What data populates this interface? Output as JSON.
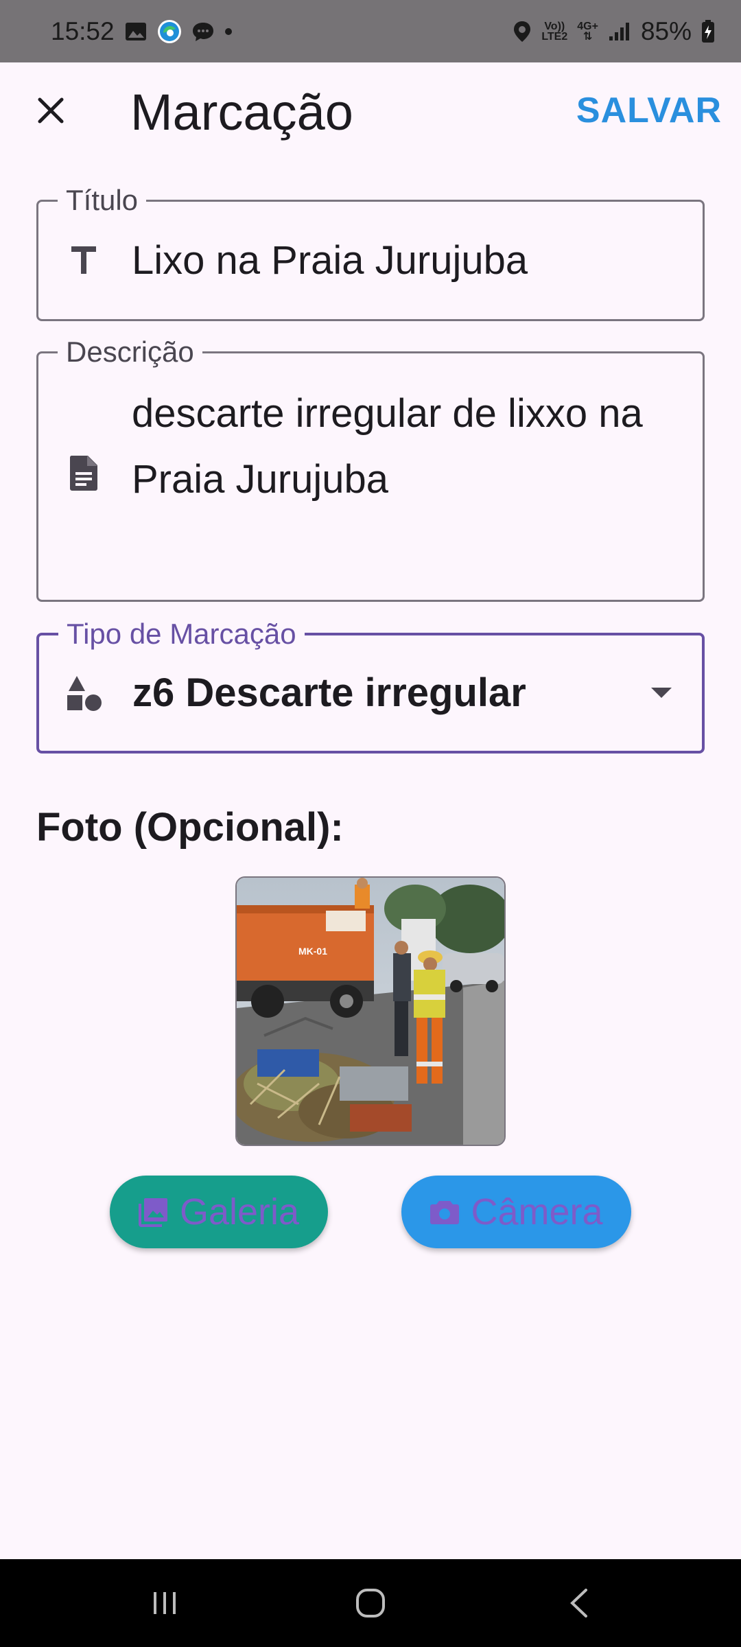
{
  "status_bar": {
    "time": "15:52",
    "left_icons": [
      "image-icon",
      "edge-browser-icon",
      "chat-bubble-icon",
      "dot-icon"
    ],
    "network_label_top": "Vo))",
    "network_label_bottom": "LTE2",
    "network_type_top": "4G+",
    "battery": "85%"
  },
  "app_bar": {
    "title": "Marcação",
    "save_label": "SALVAR"
  },
  "form": {
    "title_field": {
      "label": "Título",
      "value": "Lixo na Praia Jurujuba"
    },
    "description_field": {
      "label": "Descrição",
      "value": "descarte irregular de lixxo na Praia Jurujuba"
    },
    "type_field": {
      "label": "Tipo de Marcação",
      "value": "z6 Descarte irregular"
    }
  },
  "photo_section": {
    "label": "Foto (Opcional):",
    "truck_plate": "MK-01"
  },
  "buttons": {
    "gallery_label": "Galeria",
    "camera_label": "Câmera"
  },
  "colors": {
    "accent": "#6750a4",
    "save": "#2a8fde",
    "gallery_button": "#169e8c",
    "camera_button": "#2b97e8",
    "button_text": "#7e5bc9"
  }
}
